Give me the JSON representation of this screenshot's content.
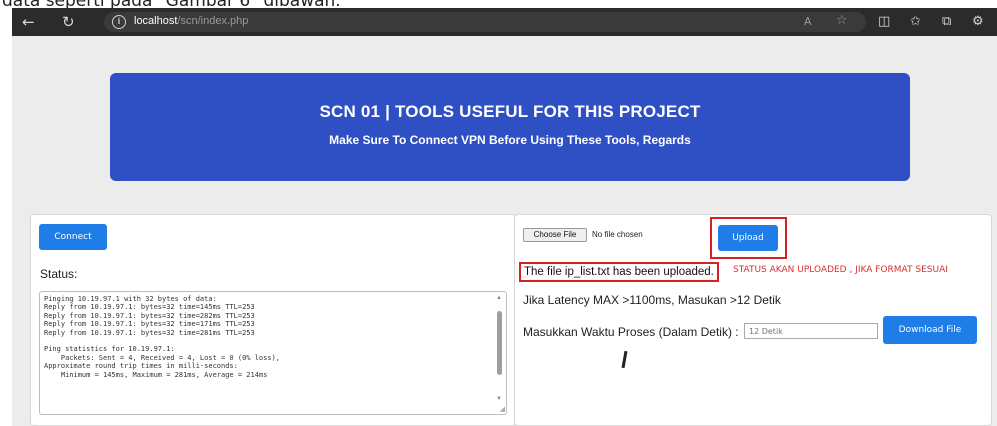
{
  "caption": {
    "text": "data seperti pada \"Gambar 6\" dibawah."
  },
  "browser": {
    "url_host": "localhost",
    "url_path": "/scn/index.php",
    "icons": [
      "back-icon",
      "refresh-icon",
      "info-icon",
      "read-aloud-icon",
      "favorite-icon",
      "split-screen-icon",
      "favorites-list-icon",
      "collections-icon",
      "extensions-icon"
    ]
  },
  "banner": {
    "title": "SCN 01 | TOOLS USEFUL FOR THIS PROJECT",
    "subtitle": "Make Sure To Connect VPN Before Using These Tools, Regards",
    "color": "#2f4fc4"
  },
  "left_panel": {
    "connect_label": "Connect",
    "status_label": "Status:",
    "console_text": "Pinging 10.19.97.1 with 32 bytes of data:\nReply from 10.19.97.1: bytes=32 time=145ms TTL=253\nReply from 10.19.97.1: bytes=32 time=282ms TTL=253\nReply from 10.19.97.1: bytes=32 time=171ms TTL=253\nReply from 10.19.97.1: bytes=32 time=281ms TTL=253\n\nPing statistics for 10.19.97.1:\n    Packets: Sent = 4, Received = 4, Lost = 0 (0% loss),\nApproximate round trip times in milli-seconds:\n    Minimum = 145ms, Maximum = 281ms, Average = 214ms"
  },
  "right_panel": {
    "choose_file_label": "Choose File",
    "no_file_text": "No file chosen",
    "upload_label": "Upload",
    "uploaded_message": "The file ip_list.txt has been uploaded.",
    "status_note": "STATUS AKAN UPLOADED , JIKA FORMAT SESUAI",
    "latency_text": "Jika Latency MAX >1100ms, Masukan >12 Detik",
    "waktu_label": "Masukkan Waktu Proses (Dalam Detik) :",
    "waktu_placeholder": "12 Detik",
    "download_label": "Download File"
  },
  "colors": {
    "accent": "#1f7de8",
    "highlight": "#d82020"
  }
}
